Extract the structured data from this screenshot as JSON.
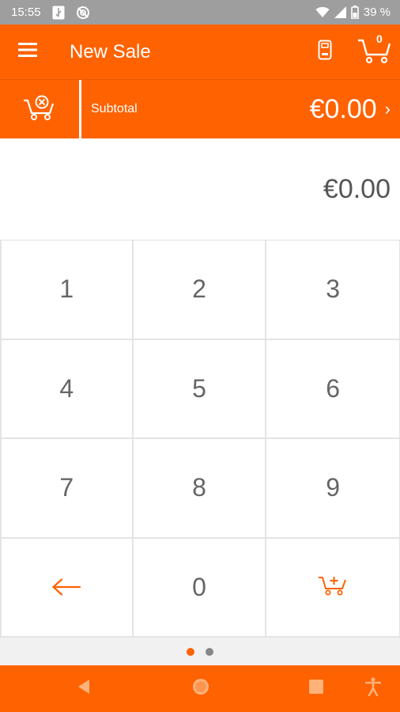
{
  "status_bar": {
    "time": "15:55",
    "battery": "39 %",
    "icons": [
      "usb-icon",
      "sync-off-icon",
      "wifi-icon",
      "signal-icon",
      "battery-icon"
    ]
  },
  "app_bar": {
    "title": "New Sale",
    "cart_count": "0",
    "icons": [
      "menu-icon",
      "card-terminal-icon",
      "shopping-cart-icon"
    ]
  },
  "subtotal_bar": {
    "label": "Subtotal",
    "amount": "€0.00",
    "chevron": "›",
    "icons": [
      "clear-cart-icon"
    ]
  },
  "amount_display": {
    "value": "€0.00"
  },
  "keypad": {
    "keys": [
      "1",
      "2",
      "3",
      "4",
      "5",
      "6",
      "7",
      "8",
      "9",
      "0"
    ],
    "icons": [
      "backspace-arrow-icon",
      "add-to-cart-icon"
    ]
  },
  "pager": {
    "pages": 2,
    "active_page": 1
  },
  "nav_bar": {
    "icons": [
      "back-icon",
      "home-icon",
      "recents-icon",
      "accessibility-icon"
    ]
  },
  "colors": {
    "brand": "#ff6200",
    "status_bar": "#9e9e9e",
    "key_text": "#666666",
    "pager_inactive": "#888888"
  }
}
